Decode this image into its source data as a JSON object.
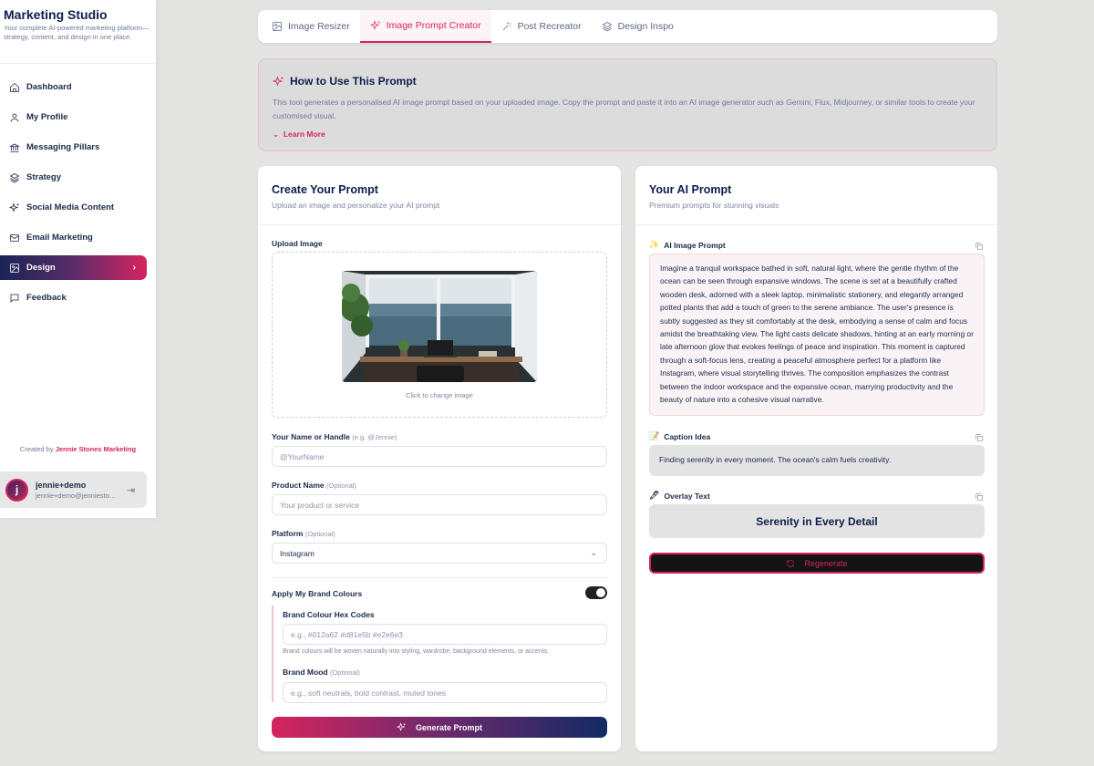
{
  "sidebar": {
    "brand_title": "Marketing Studio",
    "brand_sub": "Your complete AI-powered marketing platform—strategy, content, and design in one place.",
    "items": [
      {
        "label": "Dashboard",
        "icon": "home-icon"
      },
      {
        "label": "My Profile",
        "icon": "user-icon"
      },
      {
        "label": "Messaging Pillars",
        "icon": "pillars-icon"
      },
      {
        "label": "Strategy",
        "icon": "layers-icon"
      },
      {
        "label": "Social Media Content",
        "icon": "sparkles-icon"
      },
      {
        "label": "Email Marketing",
        "icon": "mail-icon"
      },
      {
        "label": "Design",
        "icon": "image-icon",
        "active": true
      },
      {
        "label": "Feedback",
        "icon": "message-icon"
      }
    ],
    "created_prefix": "Created by",
    "created_name": "Jennie Stones Marketing",
    "user": {
      "initial": "j",
      "name": "jennie+demo",
      "email": "jennie+demo@jenniestonesmarketing.com"
    }
  },
  "tabs": [
    {
      "label": "Image Resizer",
      "icon": "image-icon"
    },
    {
      "label": "Image Prompt Creator",
      "icon": "sparkles-icon",
      "active": true
    },
    {
      "label": "Post Recreator",
      "icon": "wand-icon"
    },
    {
      "label": "Design Inspo",
      "icon": "layers-icon"
    }
  ],
  "howto": {
    "title": "How to Use This Prompt",
    "text": "This tool generates a personalised AI image prompt based on your uploaded image. Copy the prompt and paste it into an AI image generator such as Gemini, Flux, Midjourney, or similar tools to create your customised visual.",
    "learn_more": "Learn More"
  },
  "create": {
    "title": "Create Your Prompt",
    "subtitle": "Upload an image and personalize your AI prompt",
    "upload_label": "Upload Image",
    "change_image": "Click to change image",
    "name_label": "Your Name or Handle",
    "name_hint": "(e.g. @Jennie)",
    "name_placeholder": "@YourName",
    "product_label": "Product Name",
    "optional": "(Optional)",
    "product_placeholder": "Your product or service",
    "platform_label": "Platform",
    "platform_value": "Instagram",
    "brand_colours_label": "Apply My Brand Colours",
    "brand_colours_on": true,
    "hex_label": "Brand Colour Hex Codes",
    "hex_placeholder": "e.g., #012a62 #d81e5b #e2e6e3",
    "hex_hint": "Brand colours will be woven naturally into styling, wardrobe, background elements, or accents.",
    "mood_label": "Brand Mood",
    "mood_placeholder": "e.g., soft neutrals, bold contrast, muted tones",
    "generate": "Generate Prompt"
  },
  "result": {
    "title": "Your AI Prompt",
    "subtitle": "Premium prompts for stunning visuals",
    "prompt_label": "AI Image Prompt",
    "prompt_emoji": "✨",
    "prompt_text": "Imagine a tranquil workspace bathed in soft, natural light, where the gentle rhythm of the ocean can be seen through expansive windows. The scene is set at a beautifully crafted wooden desk, adorned with a sleek laptop, minimalistic stationery, and elegantly arranged potted plants that add a touch of green to the serene ambiance. The user's presence is subtly suggested as they sit comfortably at the desk, embodying a sense of calm and focus amidst the breathtaking view. The light casts delicate shadows, hinting at an early morning or late afternoon glow that evokes feelings of peace and inspiration. This moment is captured through a soft-focus lens, creating a peaceful atmosphere perfect for a platform like Instagram, where visual storytelling thrives. The composition emphasizes the contrast between the indoor workspace and the expansive ocean, marrying productivity and the beauty of nature into a cohesive visual narrative.",
    "caption_label": "Caption Idea",
    "caption_emoji": "📝",
    "caption_text": "Finding serenity in every moment. The ocean's calm fuels creativity.",
    "overlay_label": "Overlay Text",
    "overlay_emoji": "🖊",
    "overlay_text": "Serenity in Every Detail",
    "regenerate": "Regenerate"
  },
  "colors": {
    "accent": "#d6245e",
    "navy": "#0f1d4a"
  }
}
